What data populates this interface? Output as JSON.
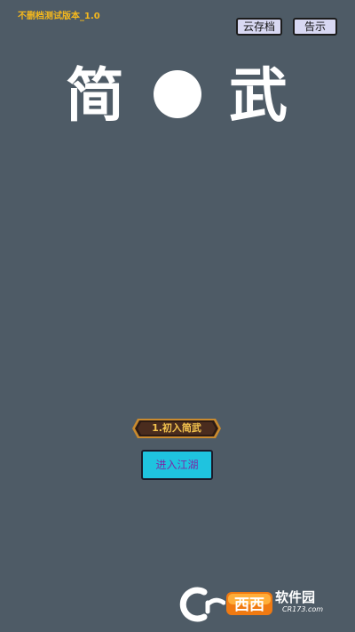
{
  "version_text": "不删档测试版本_1.0",
  "toolbar": {
    "cloud_save_label": "云存档",
    "notice_label": "告示"
  },
  "title": {
    "left_char": "简",
    "right_char": "武"
  },
  "stage_banner_label": "1.初入简武",
  "enter_button_label": "进入江湖",
  "watermark": {
    "logo_text": "西西",
    "site_name": "软件园",
    "url": "CR173.com"
  },
  "colors": {
    "background": "#4e5b66",
    "version_text": "#f5b81c",
    "enter_button": "#1fc3df",
    "banner_text": "#f3c34e"
  }
}
